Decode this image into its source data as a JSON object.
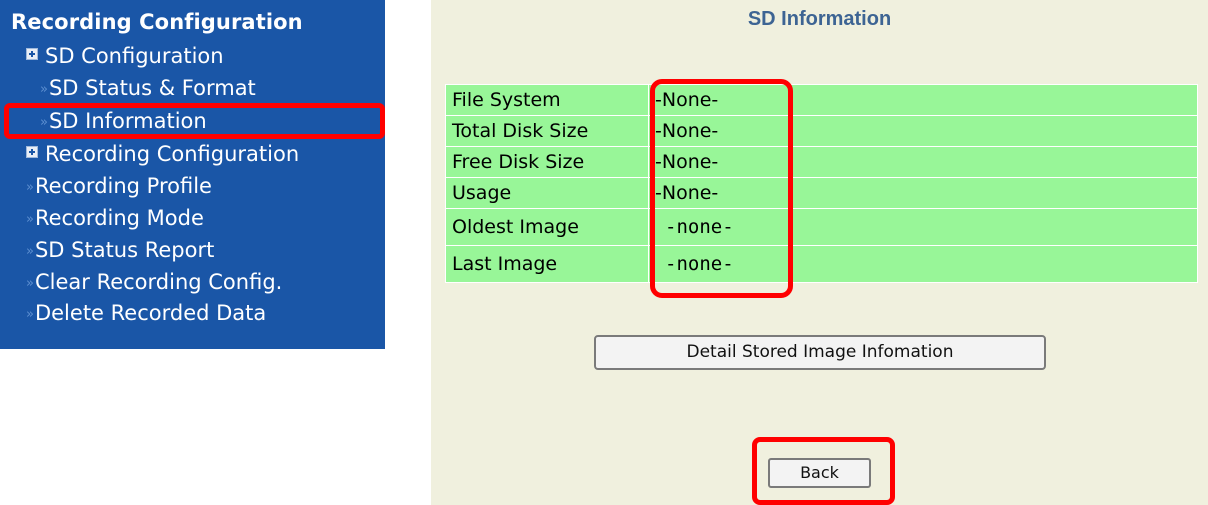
{
  "sidebar": {
    "title": "Recording Configuration",
    "items": [
      {
        "label": "SD Configuration",
        "type": "group"
      },
      {
        "label": "SD Status & Format",
        "type": "link"
      },
      {
        "label": "SD Information",
        "type": "link",
        "selected": true
      },
      {
        "label": "Recording Configuration",
        "type": "group"
      },
      {
        "label": "Recording Profile",
        "type": "link"
      },
      {
        "label": "Recording Mode",
        "type": "link"
      },
      {
        "label": "SD Status Report",
        "type": "link"
      },
      {
        "label": "Clear Recording Config.",
        "type": "link"
      },
      {
        "label": "Delete Recorded Data",
        "type": "link"
      }
    ]
  },
  "main": {
    "title": "SD Information",
    "rows": [
      {
        "label": "File System",
        "value": "-None-"
      },
      {
        "label": "Total Disk Size",
        "value": "-None-"
      },
      {
        "label": "Free Disk Size",
        "value": "-None-"
      },
      {
        "label": "Usage",
        "value": "-None-"
      },
      {
        "label": "Oldest Image",
        "value": "-none-"
      },
      {
        "label": "Last Image",
        "value": "-none-"
      }
    ],
    "detail_button": "Detail Stored Image Infomation",
    "back_button": "Back"
  },
  "colors": {
    "sidebar_bg": "#1a56a7",
    "panel_bg": "#f0f0de",
    "row_bg": "#98f698",
    "title_color": "#3d6493",
    "highlight": "#ff0000"
  }
}
